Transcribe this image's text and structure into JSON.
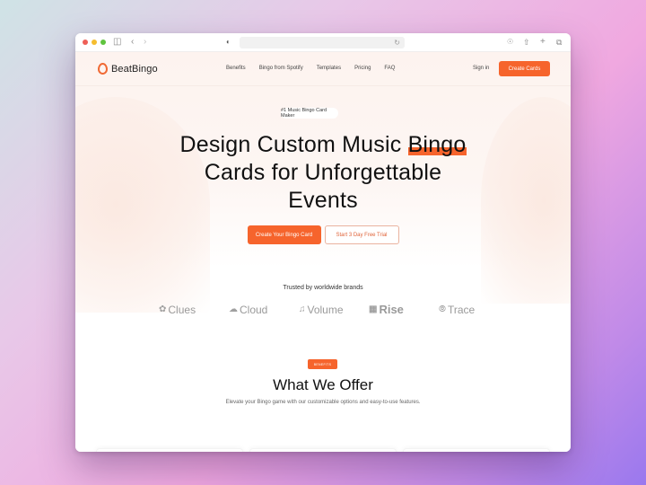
{
  "browser": {
    "traffic_lights": [
      "close",
      "minimize",
      "zoom"
    ],
    "icons": [
      "sidebar-icon",
      "back-icon",
      "forward-icon",
      "privacy-shield-icon",
      "reload-icon",
      "download-icon",
      "share-icon",
      "new-tab-icon",
      "tabs-overview-icon"
    ],
    "address_bar": ""
  },
  "nav": {
    "brand": "BeatBingo",
    "links": [
      "Benefits",
      "Bingo from Spotify",
      "Templates",
      "Pricing",
      "FAQ"
    ],
    "sign_in": "Sign in",
    "create_cards": "Create Cards"
  },
  "hero": {
    "badge": "#1 Music Bingo Card Maker",
    "headline_pre": "Design Custom Music ",
    "headline_highlight": "Bingo",
    "headline_line2": "Cards for Unforgettable",
    "headline_line3": "Events",
    "cta_primary": "Create Your Bingo Card",
    "cta_secondary": "Start 3 Day Free Trial"
  },
  "trusted": {
    "label": "Trusted by worldwide brands",
    "brands": [
      {
        "name": "Clues",
        "icon": "paw-icon"
      },
      {
        "name": "Cloud",
        "icon": "cloud-icon"
      },
      {
        "name": "Volume",
        "icon": "music-disc-icon"
      },
      {
        "name": "Rise",
        "icon": "bars-icon"
      },
      {
        "name": "Trace",
        "icon": "compass-icon"
      }
    ]
  },
  "benefits": {
    "tag": "BENEFITS",
    "title": "What We Offer",
    "subtitle": "Elevate your Bingo game with our customizable options and easy-to-use features.",
    "cards": [
      {
        "icon": "music-note-icon"
      },
      {
        "icon": "share-card-icon"
      },
      {
        "icon": "download-icon"
      }
    ]
  },
  "colors": {
    "accent": "#f6642c",
    "hero_bg": "#fdf3ef",
    "text": "#111111"
  }
}
